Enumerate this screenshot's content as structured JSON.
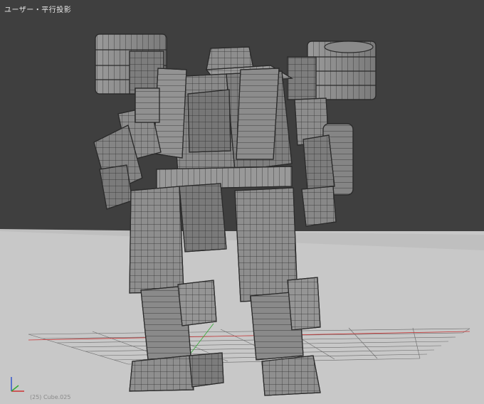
{
  "viewport": {
    "label": "ユーザー・平行投影",
    "status_text": "(25) Cube.025"
  },
  "colors": {
    "background": "#3f3f3f",
    "ground": "#c8c8c8",
    "mesh_face": "#8d8d8d",
    "mesh_edge": "#2b2b2b",
    "grid_line": "#6a6a6a",
    "axis_x": "#cc3333",
    "axis_y": "#33aa33",
    "axis_z": "#3355cc"
  },
  "axis_gizmo": {
    "icon": "xyz-axis-gizmo-icon"
  }
}
